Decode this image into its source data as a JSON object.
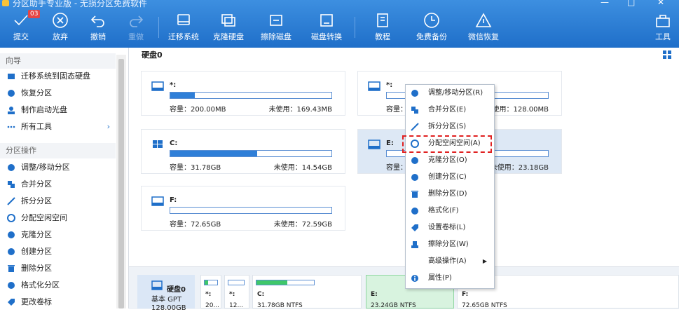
{
  "window": {
    "title": "分区助手专业版 - 无损分区免费软件",
    "controls": [
      "—",
      "□",
      "✕"
    ]
  },
  "toolbar": {
    "items": [
      {
        "label": "提交",
        "icon": "check-icon",
        "badge": "03",
        "enabled": true
      },
      {
        "label": "放弃",
        "icon": "cancel-icon",
        "enabled": true
      },
      {
        "label": "撤销",
        "icon": "undo-icon",
        "enabled": true
      },
      {
        "label": "重做",
        "icon": "redo-icon",
        "enabled": false
      },
      {
        "label": "迁移系统",
        "icon": "migrate-os-icon",
        "enabled": true
      },
      {
        "label": "克隆硬盘",
        "icon": "clone-disk-icon",
        "enabled": true
      },
      {
        "label": "擦除磁盘",
        "icon": "wipe-disk-icon",
        "enabled": true
      },
      {
        "label": "磁盘转换",
        "icon": "convert-disk-icon",
        "enabled": true
      },
      {
        "label": "教程",
        "icon": "book-icon",
        "enabled": true
      },
      {
        "label": "免费备份",
        "icon": "backup-icon",
        "enabled": true
      },
      {
        "label": "微信恢复",
        "icon": "recovery-icon",
        "enabled": true
      },
      {
        "label": "工具",
        "icon": "tools-icon",
        "enabled": true
      }
    ]
  },
  "sidebar": {
    "wizard_title": "向导",
    "wizard": [
      "迁移系统到固态硬盘",
      "恢复分区",
      "制作启动光盘",
      "所有工具"
    ],
    "ops_title": "分区操作",
    "ops": [
      "调整/移动分区",
      "合并分区",
      "拆分分区",
      "分配空闲空间",
      "克隆分区",
      "创建分区",
      "删除分区",
      "格式化分区",
      "更改卷标"
    ]
  },
  "main": {
    "disk_title": "硬盘0",
    "cap_label": "容量：",
    "free_label": "未使用：",
    "partitions": [
      {
        "name": "*:",
        "capacity": "200.00MB",
        "free": "169.43MB",
        "used_fraction": 0.15
      },
      {
        "name": "*:",
        "capacity": "",
        "free": "128.00MB",
        "used_fraction": 0.0
      },
      {
        "name": "C:",
        "capacity": "31.78GB",
        "free": "14.54GB",
        "used_fraction": 0.54
      },
      {
        "name": "E:",
        "capacity": "",
        "free": "23.18GB",
        "used_fraction": 0.0
      },
      {
        "name": "F:",
        "capacity": "72.65GB",
        "free": "72.59GB",
        "used_fraction": 0.0
      }
    ]
  },
  "bottom": {
    "disk_name": "硬盘0",
    "disk_type": "基本 GPT",
    "disk_size": "128.00GB",
    "cells": [
      {
        "name": "*:",
        "info": "20..."
      },
      {
        "name": "*:",
        "info": "12..."
      },
      {
        "name": "C:",
        "info": "31.78GB NTFS"
      },
      {
        "name": "E:",
        "info": "23.24GB NTFS"
      },
      {
        "name": "F:",
        "info": "72.65GB NTFS"
      }
    ]
  },
  "context_menu": {
    "items": [
      {
        "label": "调整/移动分区(R)",
        "icon": "resize-icon"
      },
      {
        "label": "合并分区(E)",
        "icon": "merge-icon"
      },
      {
        "label": "拆分分区(S)",
        "icon": "split-icon"
      },
      {
        "label": "分配空闲空间(A)",
        "icon": "allocate-icon",
        "highlighted": true
      },
      {
        "label": "克隆分区(O)",
        "icon": "clone-icon"
      },
      {
        "label": "创建分区(C)",
        "icon": "create-icon"
      },
      {
        "label": "删除分区(D)",
        "icon": "delete-icon"
      },
      {
        "label": "格式化(F)",
        "icon": "format-icon"
      },
      {
        "label": "设置卷标(L)",
        "icon": "label-icon"
      },
      {
        "label": "擦除分区(W)",
        "icon": "wipe-icon"
      },
      {
        "label": "高级操作(A)",
        "icon": "",
        "submenu": true
      },
      {
        "label": "属性(P)",
        "icon": "info-icon"
      }
    ]
  },
  "colors": {
    "toolbar": "#1f6fc9",
    "accent": "#2f7fd8",
    "highlight": "#e02020",
    "bar_green": "#3fc76a"
  }
}
